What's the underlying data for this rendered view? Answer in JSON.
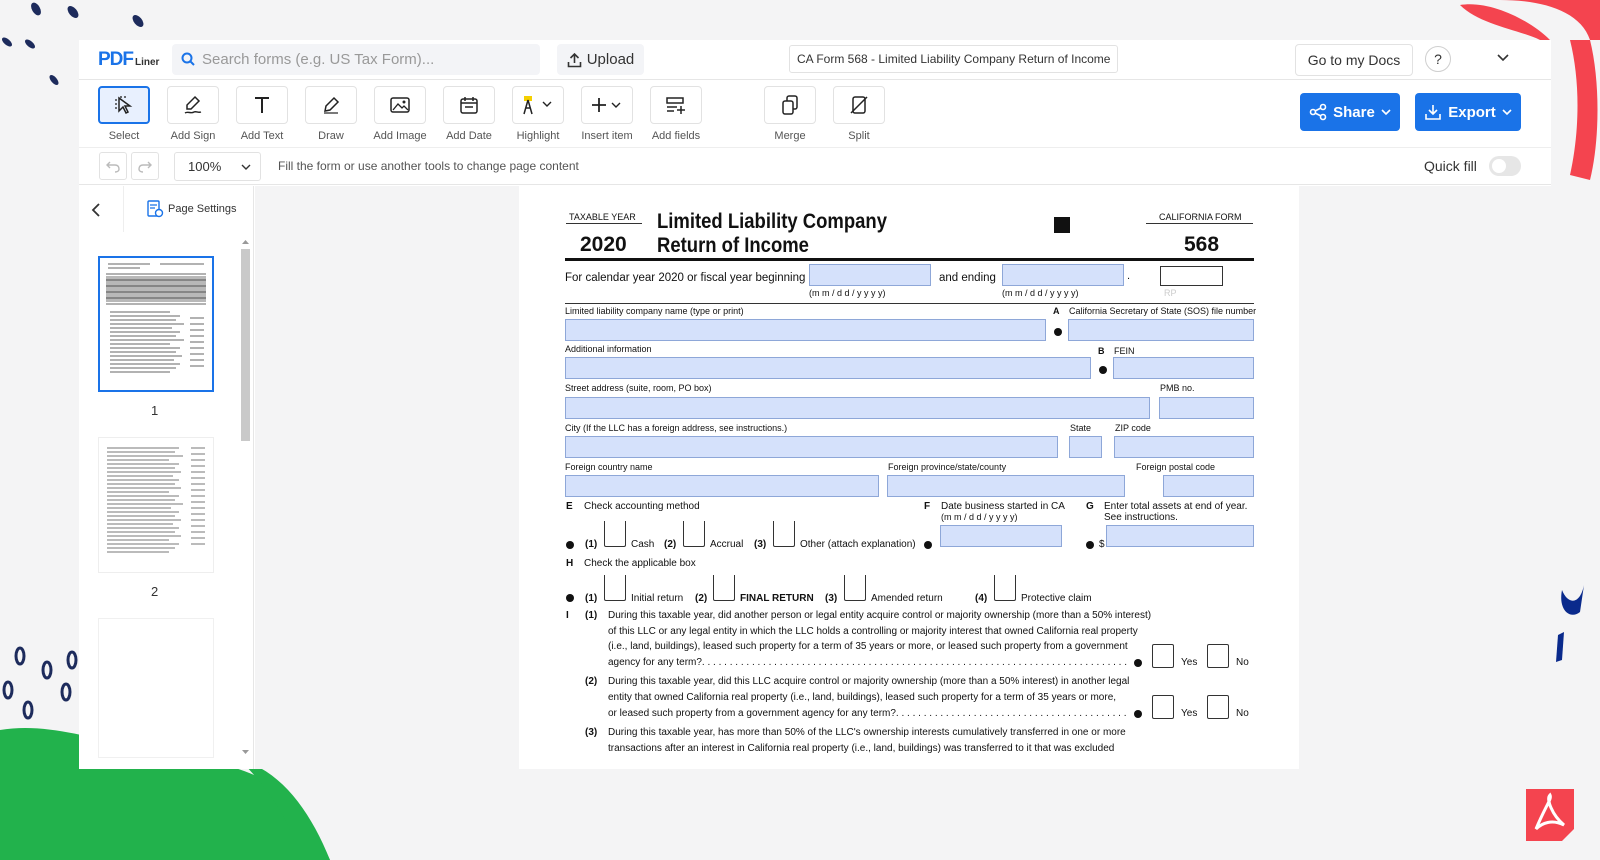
{
  "app": {
    "logo_text": "PDF",
    "logo_sub": "Liner",
    "search_placeholder": "Search forms (e.g. US Tax Form)...",
    "upload_label": "Upload",
    "document_title": "CA Form 568 - Limited Liability Company Return of Income",
    "go_to_docs_label": "Go to my Docs",
    "help_label": "?"
  },
  "toolbar": {
    "tools": [
      {
        "label": "Select"
      },
      {
        "label": "Add Sign"
      },
      {
        "label": "Add Text"
      },
      {
        "label": "Draw"
      },
      {
        "label": "Add Image"
      },
      {
        "label": "Add Date"
      },
      {
        "label": "Highlight"
      },
      {
        "label": "Insert item"
      },
      {
        "label": "Add fields"
      },
      {
        "label": "Merge"
      },
      {
        "label": "Split"
      }
    ],
    "share_label": "Share",
    "export_label": "Export",
    "accent_color": "#1a73e8"
  },
  "subbar": {
    "zoom": "100%",
    "hint": "Fill the form or use another tools to change page content",
    "quick_fill_label": "Quick fill",
    "quick_fill_on": false
  },
  "sidebar": {
    "page_settings_label": "Page Settings",
    "pages": [
      "1",
      "2"
    ]
  },
  "form": {
    "taxable_year_label": "TAXABLE YEAR",
    "year": "2020",
    "title_line1": "Limited Liability Company",
    "title_line2": "Return of Income",
    "california_form_label": "CALIFORNIA FORM",
    "form_number": "568",
    "calendar_text": "For calendar year 2020 or fiscal year beginning",
    "date_format": "(m m / d d / y y y y)",
    "and_ending": "and ending",
    "period": ".",
    "rp": "RP",
    "llc_name_label": "Limited liability company name (type or print)",
    "a_letter": "A",
    "sos_label": "California Secretary of State (SOS) file number",
    "additional_info_label": "Additional information",
    "b_letter": "B",
    "fein_label": "FEIN",
    "street_label": "Street address (suite, room, PO box)",
    "pmb_label": "PMB no.",
    "city_label": "City (If the LLC has a foreign address, see instructions.)",
    "state_label": "State",
    "zip_label": "ZIP code",
    "foreign_country_label": "Foreign country name",
    "foreign_province_label": "Foreign province/state/county",
    "foreign_postal_label": "Foreign postal code",
    "e_letter": "E",
    "e_text": "Check accounting method",
    "f_letter": "F",
    "f_text": "Date business started in CA",
    "f_format": "(m m / d d / y y y y)",
    "g_letter": "G",
    "g_text_1": "Enter total assets at end of year.",
    "g_text_2": "See instructions.",
    "dollar": "$",
    "e_options": [
      {
        "num": "(1)",
        "label": "Cash"
      },
      {
        "num": "(2)",
        "label": "Accrual"
      },
      {
        "num": "(3)",
        "label": "Other (attach explanation)"
      }
    ],
    "h_letter": "H",
    "h_text": "Check the applicable box",
    "h_options": [
      {
        "num": "(1)",
        "label": "Initial return"
      },
      {
        "num": "(2)",
        "label": "FINAL RETURN"
      },
      {
        "num": "(3)",
        "label": "Amended return"
      },
      {
        "num": "(4)",
        "label": "Protective claim"
      }
    ],
    "i_letter": "I",
    "i1_num": "(1)",
    "i1_l1": "During this taxable year, did another person or legal entity acquire control or majority ownership (more than a 50% interest)",
    "i1_l2": "of this LLC or any legal entity in which the LLC holds a controlling or majority interest that owned California real property",
    "i1_l3": "(i.e., land, buildings), leased such property for a term of 35 years or more, or leased such property from a government",
    "i1_l4": "agency for any term?. . . . . . . . . . . . . . . . . . . . . . . . . . . . . . . . . . . . . . . . . . . . . . . . . . . . . . . . . . . . . . . . . . . . . . . . . . . . . .",
    "i2_num": "(2)",
    "i2_l1": "During this taxable year, did this LLC acquire control or majority ownership (more than a 50% interest) in another legal",
    "i2_l2": "entity that owned California real property (i.e., land, buildings), leased such property for a term of 35 years or more,",
    "i2_l3": "or leased such property from a government agency for any term?. . . . . . . . . . . . . . . . . . . . . . . . . . . . . . . . . . . . . . . . . . . . .",
    "i3_num": "(3)",
    "i3_l1": "During this taxable year, has more than 50% of the LLC's ownership interests cumulatively transferred in one or more",
    "i3_l2": "transactions after an interest in California real property (i.e., land, buildings) was transferred to it that was excluded",
    "yes": "Yes",
    "no": "No",
    "field_color": "#d5e1fb"
  }
}
